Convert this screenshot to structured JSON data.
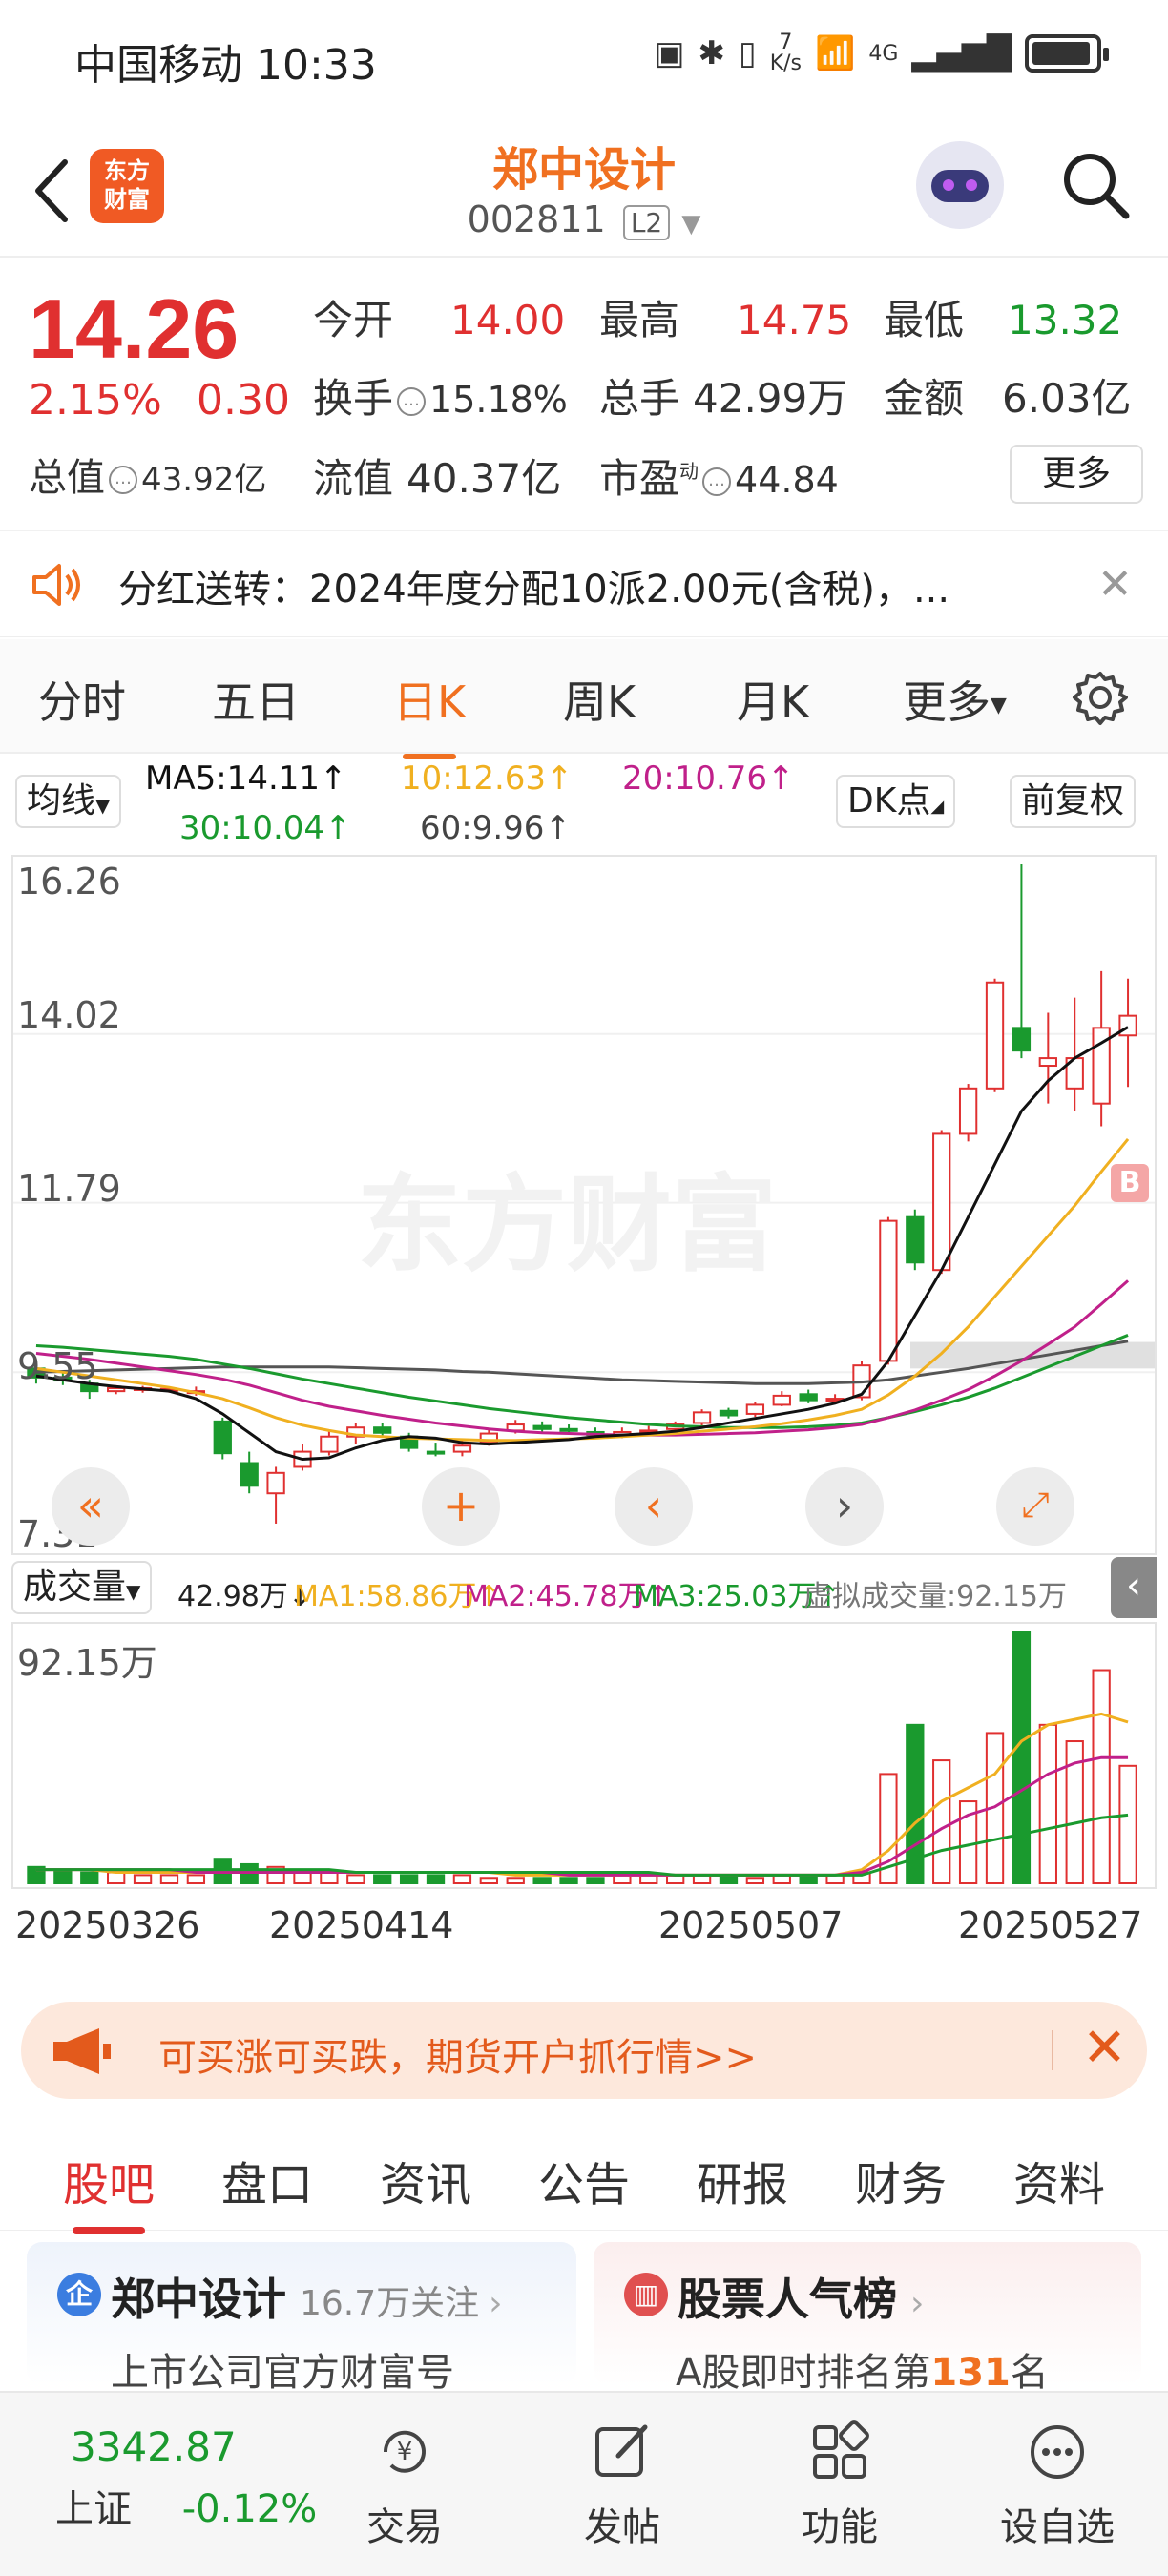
{
  "status_bar": {
    "carrier_time": "中国移动 10:33",
    "speed_num": "7",
    "speed_unit": "K/s",
    "network": "4G",
    "wifi_sup": "6"
  },
  "header": {
    "logo_line1": "东方",
    "logo_line2": "财富",
    "title": "郑中设计",
    "code": "002811",
    "level": "L2"
  },
  "quote": {
    "price": "14.26",
    "pct": "2.15%",
    "change": "0.30",
    "open_label": "今开",
    "open": "14.00",
    "high_label": "最高",
    "high": "14.75",
    "low_label": "最低",
    "low": "13.32",
    "turnover_label": "换手",
    "turnover": "15.18%",
    "volume_label": "总手",
    "volume": "42.99万",
    "amount_label": "金额",
    "amount": "6.03亿",
    "mktcap_label": "总值",
    "mktcap": "43.92亿",
    "float_label": "流值",
    "float": "40.37亿",
    "pe_label": "市盈",
    "pe_sup": "动",
    "pe": "44.84",
    "more": "更多"
  },
  "dividend": {
    "text": "分红送转：2024年度分配10派2.00元(含税)，..."
  },
  "period_tabs": [
    "分时",
    "五日",
    "日K",
    "周K",
    "月K",
    "更多"
  ],
  "active_period": "日K",
  "ma_legend": {
    "selector": "均线",
    "ma5": "MA5:14.11↑",
    "ma10": "10:12.63↑",
    "ma20": "20:10.76↑",
    "ma30": "30:10.04↑",
    "ma60": "60:9.96↑",
    "dk_button": "DK点",
    "adjust_button": "前复权"
  },
  "chart_axis": {
    "y_top": "16.26",
    "y_2": "14.02",
    "y_3": "11.79",
    "y_4": "9.55",
    "y_bottom": "7.31",
    "watermark": "东方财富",
    "b_marker": "B"
  },
  "volume_legend": {
    "selector": "成交量",
    "vol": "42.98万↓",
    "ma1": "MA1:58.86万↑",
    "ma2": "MA2:45.78万↑",
    "ma3": "MA3:25.03万↑",
    "virtual": "虚拟成交量:92.15万",
    "y_top": "92.15万"
  },
  "x_axis": [
    "20250326",
    "20250414",
    "20250507",
    "20250527"
  ],
  "colors": {
    "up": "#e03030",
    "down": "#1a9a2e",
    "accent": "#f07020",
    "ma5": "#111111",
    "ma10": "#f0b020",
    "ma20": "#c0208a",
    "ma30": "#1a9a2e",
    "ma60": "#555555"
  },
  "chart_data": {
    "type": "candlestick",
    "y_range": [
      7.31,
      16.26
    ],
    "candles": [
      {
        "o": 9.6,
        "c": 9.48,
        "h": 9.68,
        "l": 9.4
      },
      {
        "o": 9.48,
        "c": 9.44,
        "h": 9.55,
        "l": 9.38
      },
      {
        "o": 9.4,
        "c": 9.3,
        "h": 9.45,
        "l": 9.2
      },
      {
        "o": 9.3,
        "c": 9.34,
        "h": 9.38,
        "l": 9.26
      },
      {
        "o": 9.32,
        "c": 9.34,
        "h": 9.37,
        "l": 9.28
      },
      {
        "o": 9.33,
        "c": 9.33,
        "h": 9.36,
        "l": 9.28
      },
      {
        "o": 9.3,
        "c": 9.3,
        "h": 9.36,
        "l": 9.24
      },
      {
        "o": 8.9,
        "c": 8.48,
        "h": 8.95,
        "l": 8.4
      },
      {
        "o": 8.35,
        "c": 8.05,
        "h": 8.5,
        "l": 7.95
      },
      {
        "o": 7.95,
        "c": 8.22,
        "h": 8.3,
        "l": 7.55
      },
      {
        "o": 8.3,
        "c": 8.5,
        "h": 8.6,
        "l": 8.25
      },
      {
        "o": 8.5,
        "c": 8.7,
        "h": 8.78,
        "l": 8.45
      },
      {
        "o": 8.7,
        "c": 8.82,
        "h": 8.88,
        "l": 8.6
      },
      {
        "o": 8.82,
        "c": 8.75,
        "h": 8.88,
        "l": 8.7
      },
      {
        "o": 8.7,
        "c": 8.55,
        "h": 8.75,
        "l": 8.5
      },
      {
        "o": 8.5,
        "c": 8.48,
        "h": 8.62,
        "l": 8.44
      },
      {
        "o": 8.5,
        "c": 8.58,
        "h": 8.66,
        "l": 8.44
      },
      {
        "o": 8.62,
        "c": 8.74,
        "h": 8.8,
        "l": 8.58
      },
      {
        "o": 8.78,
        "c": 8.86,
        "h": 8.92,
        "l": 8.74
      },
      {
        "o": 8.84,
        "c": 8.8,
        "h": 8.9,
        "l": 8.76
      },
      {
        "o": 8.8,
        "c": 8.78,
        "h": 8.86,
        "l": 8.74
      },
      {
        "o": 8.76,
        "c": 8.72,
        "h": 8.82,
        "l": 8.7
      },
      {
        "o": 8.72,
        "c": 8.76,
        "h": 8.82,
        "l": 8.68
      },
      {
        "o": 8.76,
        "c": 8.78,
        "h": 8.84,
        "l": 8.72
      },
      {
        "o": 8.8,
        "c": 8.86,
        "h": 8.9,
        "l": 8.76
      },
      {
        "o": 8.88,
        "c": 9.02,
        "h": 9.06,
        "l": 8.84
      },
      {
        "o": 9.04,
        "c": 8.98,
        "h": 9.08,
        "l": 8.94
      },
      {
        "o": 9.0,
        "c": 9.12,
        "h": 9.16,
        "l": 8.96
      },
      {
        "o": 9.12,
        "c": 9.24,
        "h": 9.3,
        "l": 9.1
      },
      {
        "o": 9.26,
        "c": 9.18,
        "h": 9.32,
        "l": 9.14
      },
      {
        "o": 9.2,
        "c": 9.2,
        "h": 9.26,
        "l": 9.14
      },
      {
        "o": 9.22,
        "c": 9.64,
        "h": 9.7,
        "l": 9.18
      },
      {
        "o": 9.7,
        "c": 11.55,
        "h": 11.6,
        "l": 9.65
      },
      {
        "o": 11.6,
        "c": 11.0,
        "h": 11.7,
        "l": 10.9
      },
      {
        "o": 10.9,
        "c": 12.7,
        "h": 12.75,
        "l": 10.85
      },
      {
        "o": 12.7,
        "c": 13.3,
        "h": 13.36,
        "l": 12.6
      },
      {
        "o": 13.3,
        "c": 14.7,
        "h": 14.75,
        "l": 13.25
      },
      {
        "o": 14.1,
        "c": 13.8,
        "h": 16.26,
        "l": 13.7
      },
      {
        "o": 13.6,
        "c": 13.7,
        "h": 14.3,
        "l": 13.1
      },
      {
        "o": 13.3,
        "c": 13.7,
        "h": 14.5,
        "l": 13.0
      },
      {
        "o": 13.1,
        "c": 14.1,
        "h": 14.85,
        "l": 12.8
      },
      {
        "o": 14.0,
        "c": 14.26,
        "h": 14.75,
        "l": 13.32
      }
    ],
    "ma5": [
      9.5,
      9.45,
      9.4,
      9.36,
      9.33,
      9.3,
      9.2,
      9.0,
      8.75,
      8.5,
      8.4,
      8.42,
      8.55,
      8.65,
      8.7,
      8.68,
      8.62,
      8.6,
      8.62,
      8.64,
      8.66,
      8.7,
      8.72,
      8.74,
      8.77,
      8.82,
      8.88,
      8.94,
      9.0,
      9.06,
      9.14,
      9.26,
      9.7,
      10.3,
      10.9,
      11.6,
      12.3,
      13.0,
      13.4,
      13.7,
      13.9,
      14.11
    ],
    "ma10": [
      9.6,
      9.55,
      9.5,
      9.45,
      9.4,
      9.35,
      9.28,
      9.2,
      9.08,
      8.95,
      8.85,
      8.78,
      8.72,
      8.7,
      8.68,
      8.67,
      8.66,
      8.65,
      8.65,
      8.66,
      8.67,
      8.68,
      8.7,
      8.72,
      8.74,
      8.77,
      8.8,
      8.83,
      8.87,
      8.92,
      8.98,
      9.06,
      9.25,
      9.5,
      9.8,
      10.15,
      10.55,
      10.95,
      11.35,
      11.75,
      12.2,
      12.63
    ],
    "ma20": [
      9.8,
      9.76,
      9.72,
      9.67,
      9.62,
      9.57,
      9.52,
      9.46,
      9.38,
      9.28,
      9.18,
      9.1,
      9.04,
      8.98,
      8.93,
      8.88,
      8.84,
      8.8,
      8.77,
      8.75,
      8.74,
      8.73,
      8.72,
      8.72,
      8.72,
      8.73,
      8.74,
      8.75,
      8.77,
      8.79,
      8.82,
      8.86,
      8.95,
      9.05,
      9.18,
      9.32,
      9.5,
      9.7,
      9.92,
      10.15,
      10.45,
      10.76
    ],
    "ma30": [
      9.9,
      9.88,
      9.85,
      9.82,
      9.79,
      9.76,
      9.72,
      9.66,
      9.6,
      9.53,
      9.46,
      9.4,
      9.34,
      9.28,
      9.22,
      9.17,
      9.12,
      9.07,
      9.03,
      8.99,
      8.95,
      8.92,
      8.89,
      8.86,
      8.84,
      8.83,
      8.82,
      8.82,
      8.82,
      8.83,
      8.85,
      8.88,
      8.95,
      9.03,
      9.12,
      9.22,
      9.34,
      9.48,
      9.62,
      9.76,
      9.9,
      10.04
    ],
    "ma60": [
      9.55,
      9.56,
      9.57,
      9.58,
      9.59,
      9.6,
      9.61,
      9.62,
      9.62,
      9.62,
      9.62,
      9.62,
      9.61,
      9.6,
      9.59,
      9.58,
      9.56,
      9.55,
      9.53,
      9.51,
      9.49,
      9.47,
      9.45,
      9.44,
      9.43,
      9.42,
      9.41,
      9.4,
      9.4,
      9.4,
      9.41,
      9.42,
      9.45,
      9.5,
      9.55,
      9.6,
      9.66,
      9.72,
      9.78,
      9.84,
      9.9,
      9.96
    ],
    "volume_range": [
      0,
      92.15
    ],
    "volume": [
      6,
      5,
      4,
      4,
      3,
      3,
      3,
      9,
      7,
      6,
      4,
      4,
      3,
      3,
      3,
      3,
      3,
      2,
      2,
      2,
      2,
      2,
      3,
      3,
      3,
      3,
      3,
      2,
      3,
      3,
      3,
      4,
      40,
      58,
      45,
      30,
      55,
      92,
      58,
      52,
      78,
      43
    ],
    "vol_ma1": [
      5,
      5,
      5,
      4,
      4,
      4,
      4,
      4,
      4,
      4,
      4,
      4,
      4,
      4,
      4,
      4,
      4,
      4,
      3,
      3,
      3,
      3,
      3,
      3,
      3,
      3,
      3,
      3,
      3,
      3,
      3,
      5,
      12,
      22,
      30,
      35,
      40,
      52,
      58,
      60,
      62,
      59
    ],
    "vol_ma2": [
      5,
      5,
      5,
      5,
      5,
      5,
      4,
      4,
      4,
      4,
      4,
      4,
      4,
      4,
      4,
      4,
      4,
      4,
      4,
      4,
      3,
      3,
      3,
      3,
      3,
      3,
      3,
      3,
      3,
      3,
      3,
      4,
      8,
      14,
      20,
      25,
      28,
      34,
      40,
      44,
      46,
      46
    ],
    "vol_ma3": [
      5,
      5,
      5,
      5,
      5,
      5,
      5,
      5,
      5,
      5,
      5,
      5,
      4,
      4,
      4,
      4,
      4,
      4,
      4,
      4,
      4,
      4,
      4,
      4,
      3,
      3,
      3,
      3,
      3,
      3,
      3,
      3,
      6,
      9,
      12,
      14,
      16,
      18,
      20,
      22,
      24,
      25
    ],
    "x_labels": [
      "20250326",
      "20250414",
      "20250507",
      "20250527"
    ]
  },
  "promo": {
    "text": "可买涨可买跌，期货开户抓行情>>"
  },
  "bottom_tabs": [
    "股吧",
    "盘口",
    "资讯",
    "公告",
    "研报",
    "财务",
    "资料"
  ],
  "cards": {
    "left_title": "郑中设计",
    "left_follow": "16.7万关注",
    "left_sub": "上市公司官方财富号",
    "right_title": "股票人气榜",
    "right_sub_prefix": "A股即时排名第",
    "right_rank": "131",
    "right_sub_suffix": "名"
  },
  "bottom_nav": {
    "index_value": "3342.87",
    "index_name": "上证",
    "index_change": "-0.12%",
    "items": [
      "交易",
      "发帖",
      "功能",
      "设自选"
    ]
  }
}
